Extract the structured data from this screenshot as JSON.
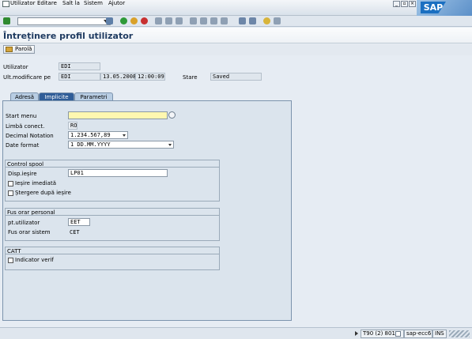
{
  "menu": {
    "items": [
      "Utilizator",
      "Editare",
      "Salt la",
      "Sistem",
      "Ajutor"
    ]
  },
  "title": "Întreținere profil utilizator",
  "appbar": {
    "parola_label": "Parolă"
  },
  "header": {
    "user_label": "Utilizator",
    "user_value": "EDI",
    "lastmod_label": "Ult.modificare pe",
    "lastmod_user": "EDI",
    "lastmod_date": "13.05.2008",
    "lastmod_time": "12:00:09",
    "status_label": "Stare",
    "status_value": "Saved"
  },
  "tabs": [
    {
      "label": "Adresă",
      "active": false
    },
    {
      "label": "Implicite",
      "active": true
    },
    {
      "label": "Parametri",
      "active": false
    }
  ],
  "defaults": {
    "start_menu_label": "Start menu",
    "start_menu_value": "",
    "lang_label": "Limbă conect.",
    "lang_value": "RO",
    "decimal_label": "Decimal Notation",
    "decimal_value": "1.234.567,89",
    "date_label": "Date format",
    "date_value": "1 DD.MM.YYYY"
  },
  "spool": {
    "title": "Control spool",
    "device_label": "Disp.ieșire",
    "device_value": "LP01",
    "immediate_label": "Ieșire imediată",
    "immediate_checked": false,
    "delete_label": "Ștergere după ieșire",
    "delete_checked": false
  },
  "timezone": {
    "title": "Fus orar personal",
    "user_label": "pt.utilizator",
    "user_value": "EET",
    "system_label": "Fus orar sistem",
    "system_value": "CET"
  },
  "catt": {
    "title": "CATT",
    "verif_label": "Indicator verif",
    "verif_checked": false
  },
  "status": {
    "session": "T90 (2) 801",
    "server": "sap-ecc6",
    "mode": "INS"
  },
  "colors": {
    "accent": "#2f5d98",
    "required_field": "#fff7b0",
    "panel": "#dbe4ed"
  }
}
